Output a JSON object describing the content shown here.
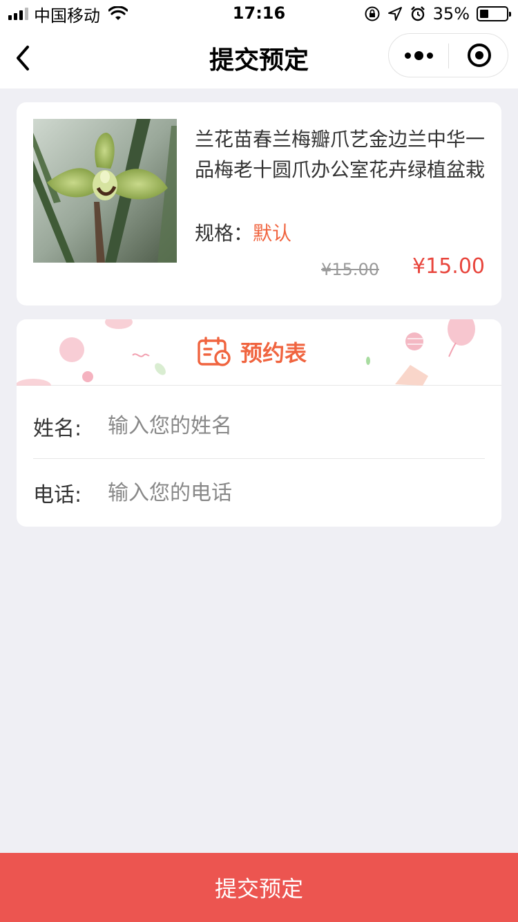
{
  "status_bar": {
    "carrier": "中国移动",
    "time": "17:16",
    "battery_percent": "35%",
    "battery_level": 0.35
  },
  "nav": {
    "title": "提交预定",
    "back_icon": "chevron-left-icon",
    "more_icon": "more-dots-icon",
    "close_icon": "target-circle-icon"
  },
  "product": {
    "title": " 兰花苗春兰梅瓣爪艺金边兰中华一品梅老十圆爪办公室花卉绿植盆栽",
    "spec_label": "规格：",
    "spec_value": "默认",
    "price_original": "¥15.00",
    "price_current": "¥15.00"
  },
  "form": {
    "title": "预约表",
    "title_icon": "calendar-clock-icon",
    "fields": [
      {
        "label": "姓名:",
        "placeholder": "输入您的姓名",
        "value": ""
      },
      {
        "label": "电话:",
        "placeholder": "输入您的电话",
        "value": ""
      }
    ]
  },
  "submit": {
    "label": "提交预定"
  },
  "colors": {
    "accent": "#f0643f",
    "price": "#e8453c",
    "submit_bg": "#ec5550",
    "page_bg": "#efeff4"
  }
}
